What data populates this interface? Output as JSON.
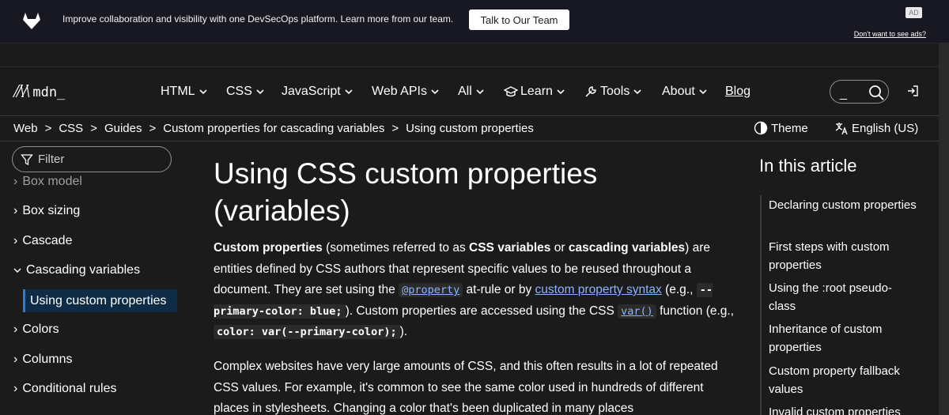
{
  "banner": {
    "text": "Improve collaboration and visibility with one DevSecOps platform. Learn more from our team.",
    "button": "Talk to Our Team",
    "ad_badge": "AD",
    "ad_link": "Don't want to see ads?"
  },
  "logo": {
    "mark": "M",
    "text": "mdn_"
  },
  "nav": {
    "items": [
      "HTML",
      "CSS",
      "JavaScript",
      "Web APIs",
      "All",
      "Learn",
      "Tools",
      "About",
      "Blog"
    ],
    "search_placeholder": "_"
  },
  "breadcrumb": [
    "Web",
    "CSS",
    "Guides",
    "Custom properties for cascading variables",
    "Using custom properties"
  ],
  "controls": {
    "theme": "Theme",
    "language": "English (US)"
  },
  "sidebar": {
    "filter": "Filter",
    "items": [
      "Box model",
      "Box sizing",
      "Cascade",
      "Cascading variables",
      "Using custom properties",
      "Colors",
      "Columns",
      "Conditional rules"
    ]
  },
  "article": {
    "title_line1": "Using CSS custom properties",
    "title_line2": "(variables)",
    "p1": {
      "b1": "Custom properties",
      "t1": " (sometimes referred to as ",
      "b2": "CSS variables",
      "t2": " or ",
      "b3": "cascading variables",
      "t3": ") are entities defined by CSS authors that represent specific values to be reused throughout a document. They are set using the ",
      "c1": "@property",
      "t4": " at-rule or by ",
      "l1": "custom property syntax",
      "t5": " (e.g., ",
      "c2": "--primary-color: blue;",
      "t6": "). Custom properties are accessed using the CSS ",
      "c3": "var()",
      "t7": " function (e.g., ",
      "c4": "color: var(--primary-color);",
      "t8": ")."
    },
    "p2": "Complex websites have very large amounts of CSS, and this often results in a lot of repeated CSS values. For example, it's common to see the same color used in hundreds of different places in stylesheets. Changing a color that's been duplicated in many places"
  },
  "toc": {
    "title": "In this article",
    "items": [
      "Declaring custom properties",
      "First steps with custom properties",
      "Using the :root pseudo-class",
      "Inheritance of custom properties",
      "Custom property fallback values",
      "Invalid custom properties"
    ]
  }
}
